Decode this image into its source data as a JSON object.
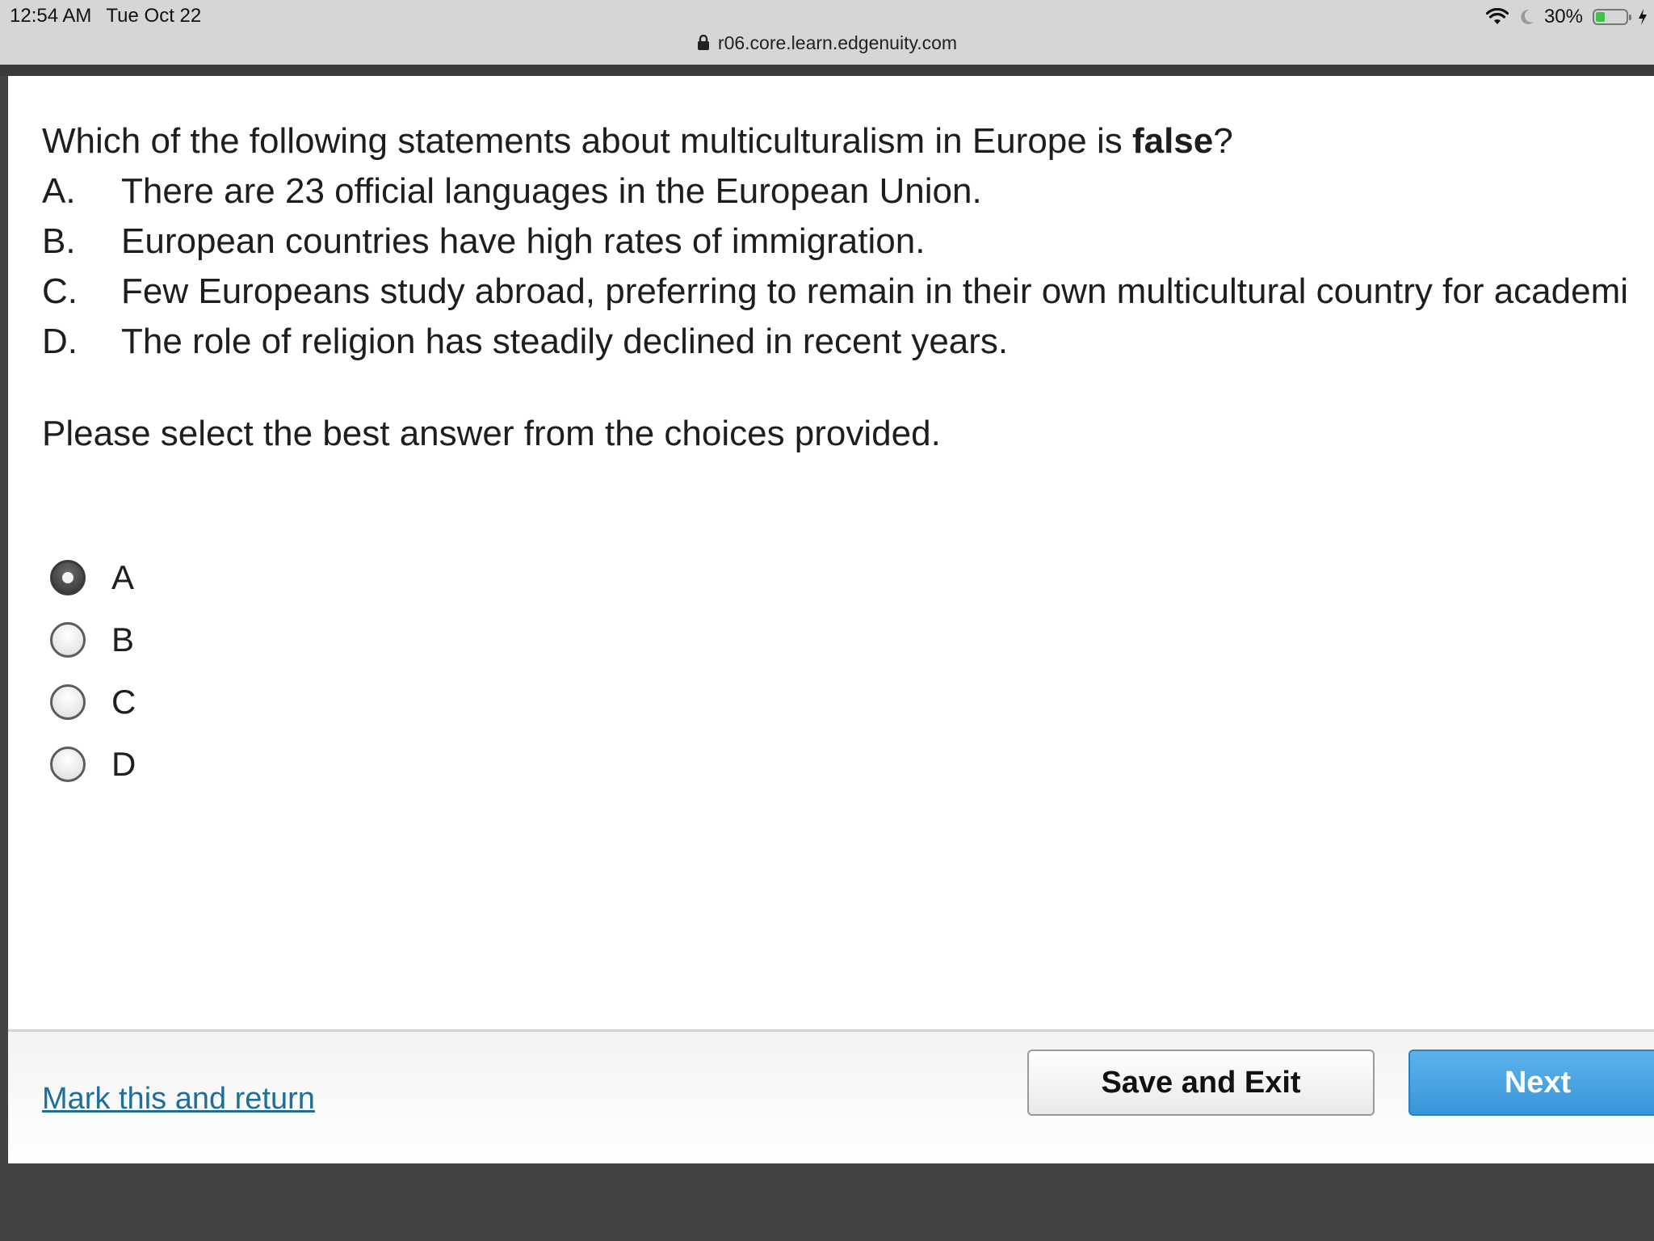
{
  "status_bar": {
    "time": "12:54 AM",
    "date": "Tue Oct 22",
    "battery_percent": "30%",
    "battery_level": 0.3,
    "icons": [
      "wifi-icon",
      "moon-icon",
      "battery-icon",
      "charging-icon"
    ]
  },
  "address_bar": {
    "url": "r06.core.learn.edgenuity.com"
  },
  "question": {
    "prompt_before": "Which of the following statements about multiculturalism in Europe is ",
    "prompt_bold": "false",
    "prompt_after": "?",
    "choices": [
      {
        "letter": "A.",
        "text": "There are 23 official languages in the European Union."
      },
      {
        "letter": "B.",
        "text": "European countries have high rates of immigration."
      },
      {
        "letter": "C.",
        "text": "Few Europeans study abroad, preferring to remain in their own multicultural country for academi"
      },
      {
        "letter": "D.",
        "text": "The role of religion has steadily declined in recent years."
      }
    ],
    "instruction": "Please select the best answer from the choices provided."
  },
  "answers": {
    "options": [
      "A",
      "B",
      "C",
      "D"
    ],
    "selected": "A"
  },
  "footer": {
    "mark_link": "Mark this and return",
    "save_label": "Save and Exit",
    "next_label": "Next"
  },
  "colors": {
    "link": "#1d6f9a",
    "next_button": "#4aa3e2",
    "page_background": "#434343"
  }
}
